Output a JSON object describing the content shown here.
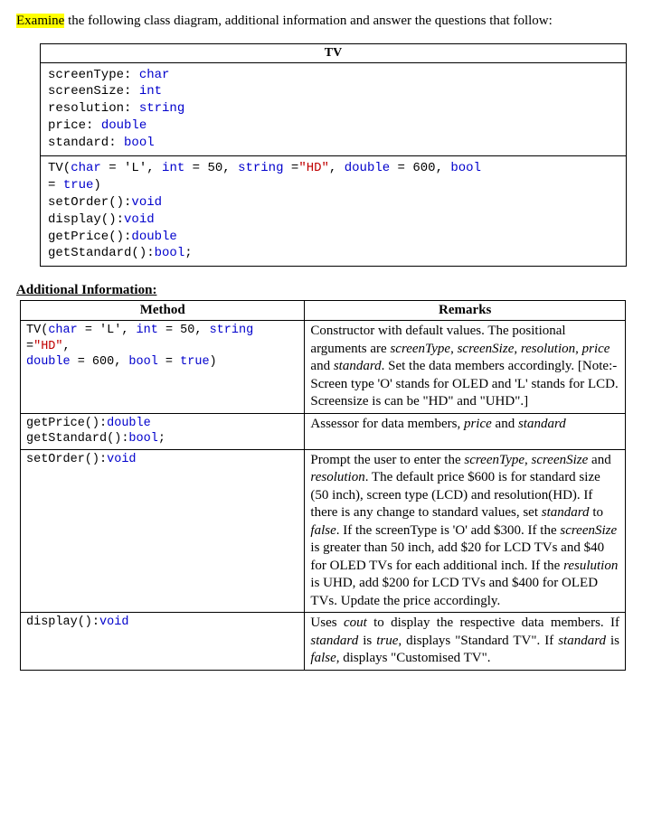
{
  "intro": {
    "hl": "Examine",
    "rest": " the following class diagram, additional information and answer the questions that follow:"
  },
  "uml": {
    "title": "TV",
    "attrs": [
      {
        "name": "screenType",
        "type": "char"
      },
      {
        "name": "screenSize",
        "type": "int"
      },
      {
        "name": "resolution",
        "type": "string"
      },
      {
        "name": "price",
        "type": "double"
      },
      {
        "name": "standard",
        "type": "bool"
      }
    ],
    "ops_line1_parts": {
      "p1": "TV(",
      "p2": "char",
      "p3": " = 'L', ",
      "p4": "int",
      "p5": " = 50, ",
      "p6": "string",
      "p7": " =",
      "p8": "\"HD\"",
      "p9": ", ",
      "p10": "double",
      "p11": " = 600, ",
      "p12": "bool"
    },
    "ops_line2_parts": {
      "p1": "= ",
      "p2": "true",
      "p3": ")"
    },
    "ops_rest": [
      {
        "sig": "setOrder():",
        "ret": "void"
      },
      {
        "sig": "display():",
        "ret": "void"
      },
      {
        "sig": "getPrice():",
        "ret": "double"
      },
      {
        "sig": "getStandard():",
        "ret": "bool",
        "tail": ";"
      }
    ]
  },
  "ai_heading": "Additional Information:",
  "table": {
    "headers": {
      "m": "Method",
      "r": "Remarks"
    },
    "rows": [
      {
        "method_parts": {
          "p1": "TV(",
          "p2": "char",
          "p3": " = 'L', ",
          "p4": "int",
          "p5": " = 50, ",
          "p6": "string",
          "p7": " =",
          "p8": "\"HD\"",
          "p9": ",\n",
          "p10": "double",
          "p11": " = 600, ",
          "p12": "bool",
          "p13": " = ",
          "p14": "true",
          "p15": ")"
        },
        "remark_parts": [
          {
            "t": "Constructor with default values.  The positional arguments are "
          },
          {
            "t": "screenType",
            "it": true
          },
          {
            "t": ", "
          },
          {
            "t": "screenSize",
            "it": true
          },
          {
            "t": ", "
          },
          {
            "t": "resolution",
            "it": true
          },
          {
            "t": ", "
          },
          {
            "t": "price",
            "it": true
          },
          {
            "t": " and "
          },
          {
            "t": "standard",
            "it": true
          },
          {
            "t": ". Set the data members accordingly. [Note:- Screen type 'O' stands for OLED and 'L' stands for LCD. Screensize is can be \"HD\" and \"UHD\".]"
          }
        ]
      },
      {
        "method_parts": {
          "p1": "getPrice():",
          "p2": "double",
          "p3": "\ngetStandard():",
          "p4": "bool",
          "p5": ";"
        },
        "remark_parts": [
          {
            "t": "Assessor for data members, "
          },
          {
            "t": "price",
            "it": true
          },
          {
            "t": " and "
          },
          {
            "t": "standard",
            "it": true
          }
        ]
      },
      {
        "method_parts": {
          "p1": "setOrder():",
          "p2": "void"
        },
        "remark_parts": [
          {
            "t": "Prompt the user to enter the "
          },
          {
            "t": "screenType",
            "it": true
          },
          {
            "t": ", "
          },
          {
            "t": "screenSize",
            "it": true
          },
          {
            "t": " and "
          },
          {
            "t": "resolution",
            "it": true
          },
          {
            "t": ". The default price $600 is for standard size (50 inch), screen type (LCD) and resolution(HD). If there is any change to standard values, set "
          },
          {
            "t": "standard",
            "it": true
          },
          {
            "t": " to "
          },
          {
            "t": "false",
            "it": true
          },
          {
            "t": ". If the screenType is 'O' add $300. If the "
          },
          {
            "t": "screenSize",
            "it": true
          },
          {
            "t": " is greater than 50 inch, add $20 for LCD TVs and $40 for OLED TVs for each additional inch.  If the "
          },
          {
            "t": "resulution",
            "it": true
          },
          {
            "t": " is UHD, add $200 for LCD TVs and $400 for OLED TVs.  Update the price accordingly."
          }
        ]
      },
      {
        "method_parts": {
          "p1": "display():",
          "p2": "void"
        },
        "remark_parts": [
          {
            "t": "Uses "
          },
          {
            "t": "cout",
            "it": true
          },
          {
            "t": " to display the respective data members.  If "
          },
          {
            "t": "standard",
            "it": true
          },
          {
            "t": " is "
          },
          {
            "t": "true",
            "it": true
          },
          {
            "t": ", displays \"Standard TV\". If "
          },
          {
            "t": "standard",
            "it": true
          },
          {
            "t": " is "
          },
          {
            "t": "false",
            "it": true
          },
          {
            "t": ", displays \"Customised TV\"."
          }
        ],
        "just": true
      }
    ]
  }
}
